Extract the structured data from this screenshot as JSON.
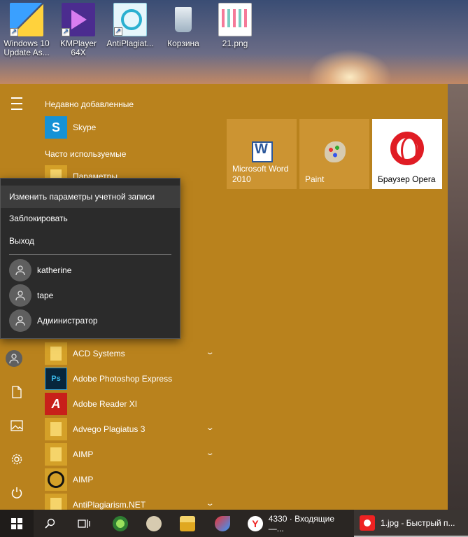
{
  "desktop": {
    "icons": [
      {
        "label": "Windows 10 Update As...",
        "icon": "windows-update-icon"
      },
      {
        "label": "KMPlayer 64X",
        "icon": "kmplayer-icon"
      },
      {
        "label": "AntiPlagiat...",
        "icon": "antiplagiat-icon"
      },
      {
        "label": "Корзина",
        "icon": "recycle-bin-icon"
      },
      {
        "label": "21.png",
        "icon": "image-file-icon"
      }
    ]
  },
  "start_menu": {
    "background_color": "#b9821d",
    "recent_header": "Недавно добавленные",
    "recent_items": [
      {
        "label": "Skype",
        "icon": "skype-icon"
      }
    ],
    "frequent_header": "Часто используемые",
    "frequent_items": [
      {
        "label": "Параметры",
        "icon": "gear-icon"
      }
    ],
    "all_apps": [
      {
        "label": "ACD Systems",
        "icon": "folder-icon",
        "expandable": true
      },
      {
        "label": "Adobe Photoshop Express",
        "icon": "photoshop-express-icon",
        "expandable": false
      },
      {
        "label": "Adobe Reader XI",
        "icon": "adobe-reader-icon",
        "expandable": false
      },
      {
        "label": "Advego Plagiatus 3",
        "icon": "folder-icon",
        "expandable": true
      },
      {
        "label": "AIMP",
        "icon": "folder-icon",
        "expandable": true
      },
      {
        "label": "AIMP",
        "icon": "aimp-icon",
        "expandable": false
      },
      {
        "label": "AntiPlagiarism.NET",
        "icon": "folder-icon",
        "expandable": true
      }
    ],
    "tiles": [
      {
        "label": "Microsoft Word 2010",
        "icon": "word-icon"
      },
      {
        "label": "Paint",
        "icon": "paint-icon"
      },
      {
        "label": "Браузер Opera",
        "icon": "opera-icon"
      }
    ]
  },
  "account_popup": {
    "actions": [
      {
        "label": "Изменить параметры учетной записи",
        "highlighted": true
      },
      {
        "label": "Заблокировать",
        "highlighted": false
      },
      {
        "label": "Выход",
        "highlighted": false
      }
    ],
    "users": [
      {
        "name": "katherine"
      },
      {
        "name": "tape"
      },
      {
        "name": "Администратор"
      }
    ]
  },
  "taskbar": {
    "apps": [
      {
        "label": "4330 · Входящие —...",
        "icon": "yandex-browser-icon"
      },
      {
        "label": "1.jpg - Быстрый п...",
        "icon": "screenshot-tool-icon"
      }
    ]
  }
}
